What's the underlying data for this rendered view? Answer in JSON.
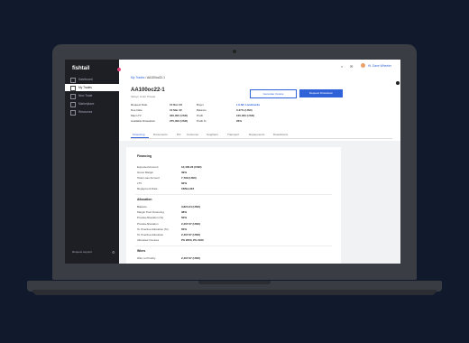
{
  "app": {
    "logo": "fishtail"
  },
  "sidebar": {
    "items": [
      {
        "label": "Dashboard",
        "active": false
      },
      {
        "label": "My Trades",
        "active": true
      },
      {
        "label": "New Trade",
        "active": false
      },
      {
        "label": "Marketplace",
        "active": false
      },
      {
        "label": "Resources",
        "active": false
      }
    ],
    "footer": "Request support"
  },
  "header": {
    "user": "Hi, Dave Wheeler"
  },
  "breadcrumb": {
    "root": "My Trades",
    "current": "AA100oc22-1"
  },
  "deal": {
    "title": "AA100oc22-1",
    "subtitle": "Sidsyn Umbr Private",
    "btn_secondary": "Generate Invoice",
    "btn_primary": "Request Drawdown",
    "col1": [
      {
        "label": "Request Date",
        "value": "10 Nov 22"
      },
      {
        "label": "Due Date",
        "value": "10 Mar 22"
      },
      {
        "label": "Max LTV",
        "value": "300,000 (USD)"
      },
      {
        "label": "Available Drawdown",
        "value": "275,000 (USD)"
      }
    ],
    "col2": [
      {
        "label": "Buyer",
        "value": "LA-NC Landmarks"
      },
      {
        "label": "Balance",
        "value": "0.37% (USD)"
      },
      {
        "label": "Profit",
        "value": "100,000 (USD)"
      },
      {
        "label": "Profit %",
        "value": "26%"
      }
    ]
  },
  "tabs": [
    "Financing",
    "Documents",
    "PO",
    "Customer",
    "Suppliers",
    "Transport",
    "Repayments",
    "Drawdowns"
  ],
  "financing": {
    "title": "Financing",
    "rows": [
      {
        "label": "Expected Amount",
        "value": "12,435.23 (USD)"
      },
      {
        "label": "Gross Margin",
        "value": "39%"
      },
      {
        "label": "Total Loan Amount",
        "value": "7,799 (USD)"
      },
      {
        "label": "LTV",
        "value": "62%"
      },
      {
        "label": "Repayment Date",
        "value": "16/Nov/23"
      }
    ]
  },
  "allocation": {
    "title": "Allocation",
    "rows": [
      {
        "label": "Balance",
        "value": "3,824.24 (USD)"
      },
      {
        "label": "Margin Pool Financing",
        "value": "38%"
      },
      {
        "label": "Prorata Allocation (%)",
        "value": "50%"
      },
      {
        "label": "Prorata Allocation",
        "value": "2,407.07 (USD)"
      },
      {
        "label": "To Overdue Allocation (%)",
        "value": "50%"
      },
      {
        "label": "To Overdue Allocation",
        "value": "2,407.07 (USD)"
      },
      {
        "label": "Allocated Invoices",
        "value": "PS 2050, PS 2160"
      }
    ]
  },
  "wires": {
    "title": "Wires",
    "rows": [
      {
        "label": "Wire to Prosthy",
        "value": "2,407.07 (USD)"
      }
    ]
  }
}
